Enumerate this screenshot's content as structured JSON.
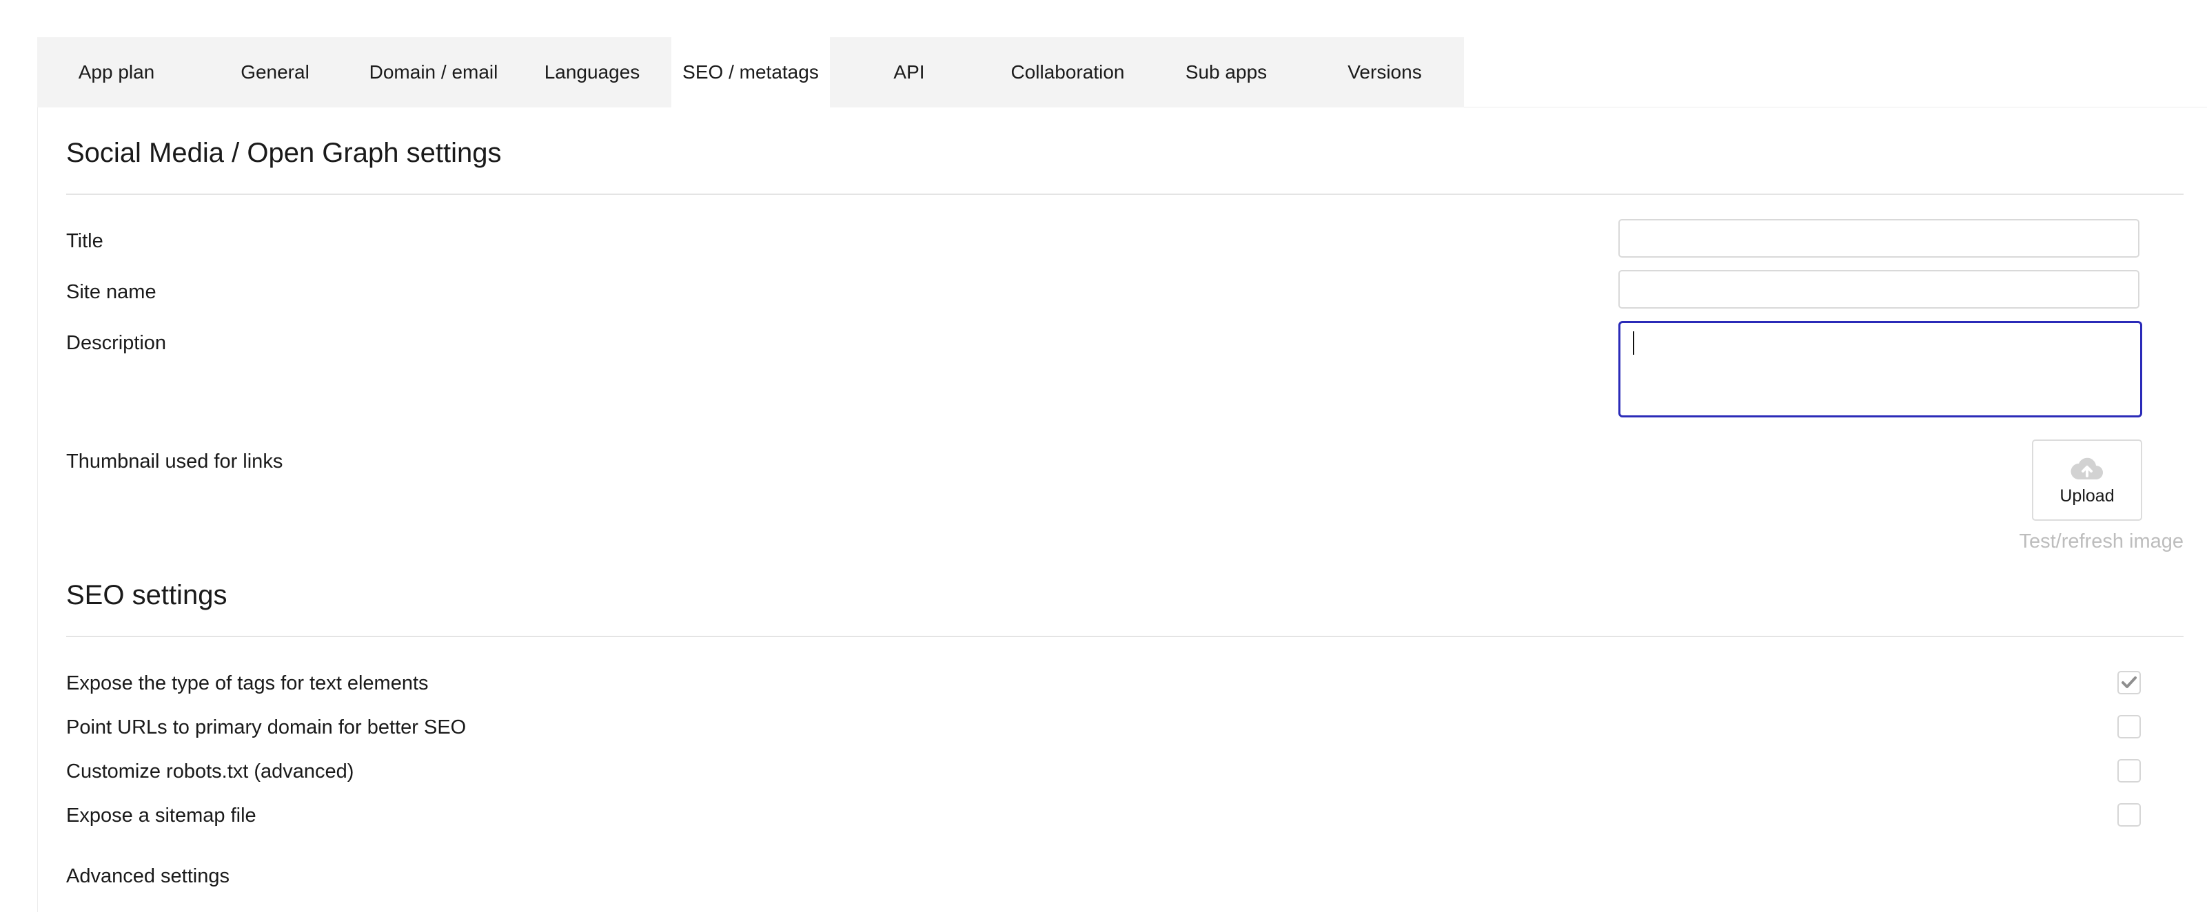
{
  "tabs": [
    {
      "label": "App plan",
      "active": false
    },
    {
      "label": "General",
      "active": false
    },
    {
      "label": "Domain / email",
      "active": false
    },
    {
      "label": "Languages",
      "active": false
    },
    {
      "label": "SEO / metatags",
      "active": true
    },
    {
      "label": "API",
      "active": false
    },
    {
      "label": "Collaboration",
      "active": false
    },
    {
      "label": "Sub apps",
      "active": false
    },
    {
      "label": "Versions",
      "active": false
    }
  ],
  "social": {
    "heading": "Social Media / Open Graph settings",
    "title_label": "Title",
    "title_value": "",
    "site_name_label": "Site name",
    "site_name_value": "",
    "description_label": "Description",
    "description_value": "",
    "thumbnail_label": "Thumbnail used for links",
    "upload_label": "Upload",
    "upload_icon": "cloud-upload-icon",
    "test_refresh_label": "Test/refresh image"
  },
  "seo": {
    "heading": "SEO settings",
    "options": [
      {
        "label": "Expose the type of tags for text elements",
        "checked": true
      },
      {
        "label": "Point URLs to primary domain for better SEO",
        "checked": false
      },
      {
        "label": "Customize robots.txt (advanced)",
        "checked": false
      },
      {
        "label": "Expose a sitemap file",
        "checked": false
      }
    ],
    "advanced_label": "Advanced settings"
  },
  "colors": {
    "tab_bar_bg": "#f3f3f3",
    "focus_border": "#2b2bb8",
    "muted_text": "#bdbdbd"
  }
}
